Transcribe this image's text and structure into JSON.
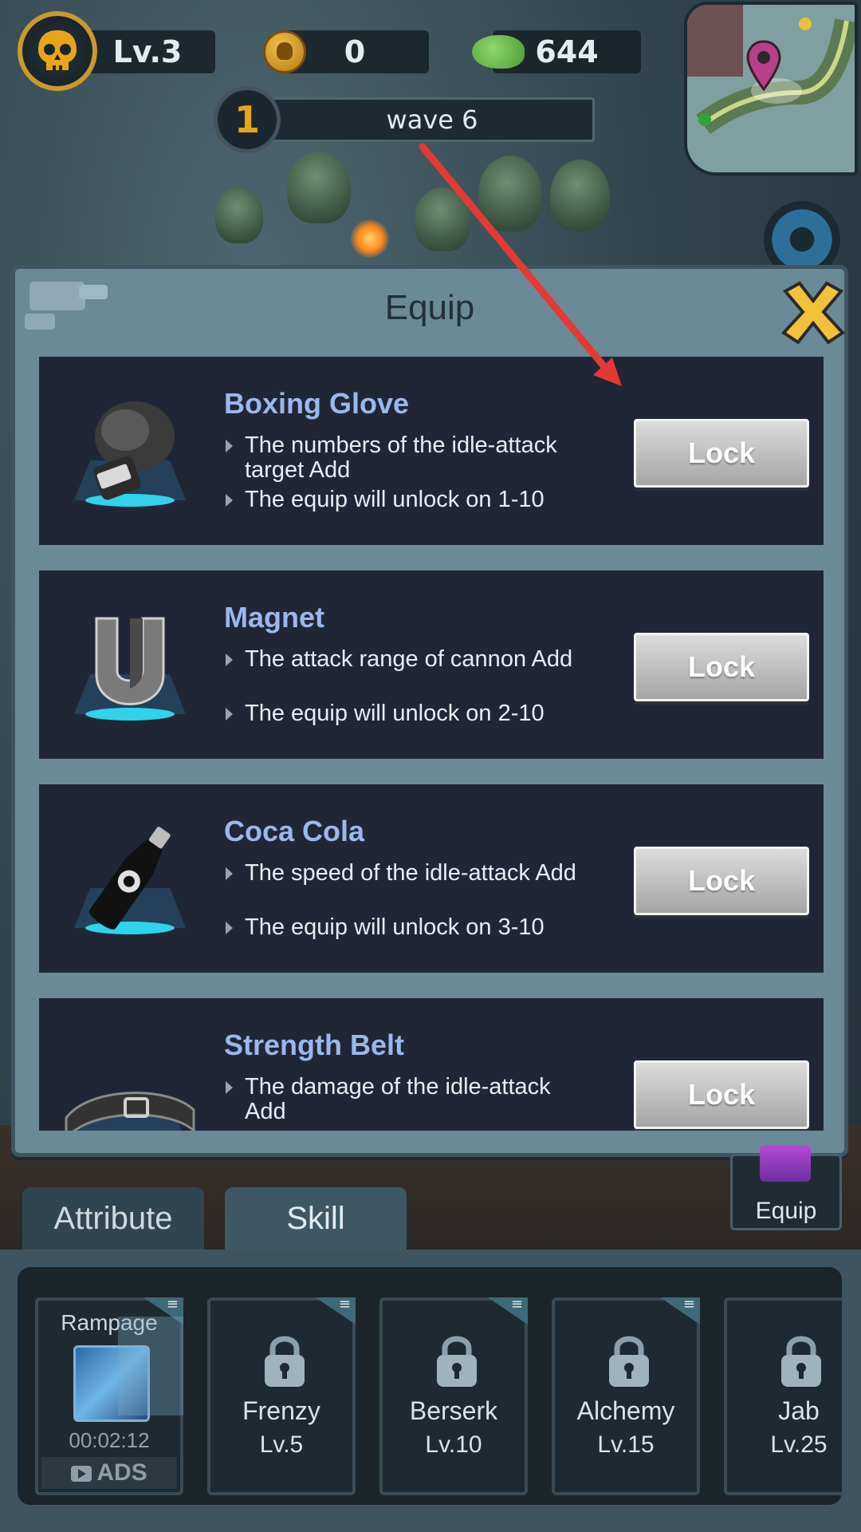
{
  "hud": {
    "level": "Lv.3",
    "coins": "0",
    "brains": "644",
    "wave_number": "1",
    "wave_label": "wave 6"
  },
  "modal": {
    "title": "Equip",
    "items": [
      {
        "name": "Boxing Glove",
        "icon": "boxing-glove-icon",
        "desc": "The numbers of the idle-attack target Add",
        "unlock": "The equip will unlock on 1-10",
        "button": "Lock"
      },
      {
        "name": "Magnet",
        "icon": "magnet-icon",
        "desc": "The attack range of cannon Add",
        "unlock": "The equip will unlock on 2-10",
        "button": "Lock"
      },
      {
        "name": "Coca Cola",
        "icon": "cola-bottle-icon",
        "desc": "The speed of the idle-attack Add",
        "unlock": "The equip will unlock on 3-10",
        "button": "Lock"
      },
      {
        "name": "Strength Belt",
        "icon": "belt-icon",
        "desc": "The damage of the idle-attack Add",
        "unlock": "",
        "button": "Lock"
      }
    ]
  },
  "tabs": {
    "attribute": "Attribute",
    "skill": "Skill",
    "equip": "Equip"
  },
  "skills": [
    {
      "name": "Rampage",
      "timer": "00:02:12",
      "ads": "ADS"
    },
    {
      "name": "Frenzy",
      "level": "Lv.5"
    },
    {
      "name": "Berserk",
      "level": "Lv.10"
    },
    {
      "name": "Alchemy",
      "level": "Lv.15"
    },
    {
      "name": "Jab",
      "level": "Lv.25"
    }
  ],
  "colors": {
    "accent_gold": "#e8a51c",
    "item_name_blue": "#9ab8ec",
    "arrow_red": "#e53935"
  }
}
